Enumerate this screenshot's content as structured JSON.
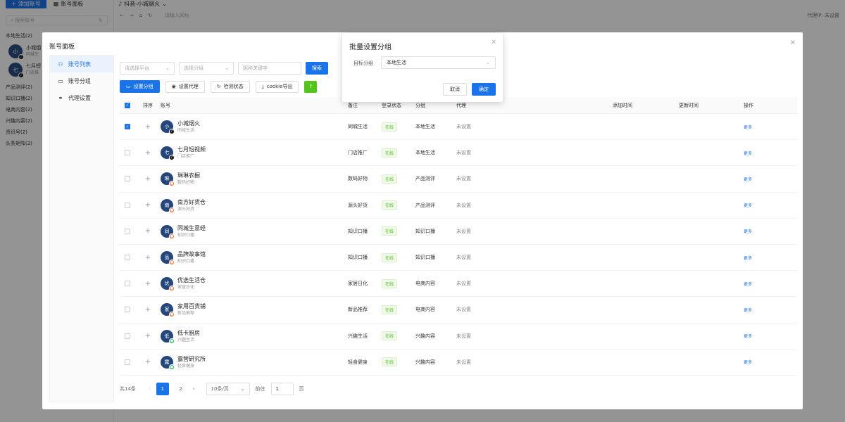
{
  "app": {
    "add_account_label": "添加账号",
    "account_panel_label": "账号面板",
    "search_placeholder": "搜索账号",
    "group_local_life": "本地生活(2)",
    "side_accounts": [
      {
        "avatar": "小",
        "name": "小城烟",
        "sub": "同城生"
      },
      {
        "avatar": "七",
        "name": "七月短",
        "sub": "门店推"
      }
    ],
    "categories": [
      "产品测评(2)",
      "知识口播(2)",
      "电商内容(2)",
      "兴趣内容(2)",
      "资讯号(2)",
      "头条矩阵(2)"
    ],
    "tab_title": "抖音-小城烟火",
    "address_placeholder": "请输入网址",
    "top_right": "代理IP: 未设置"
  },
  "panel": {
    "title": "账号面板",
    "nav": [
      {
        "label": "账号列表",
        "icon": "user-icon",
        "active": true
      },
      {
        "label": "账号分组",
        "icon": "folder-icon",
        "active": false
      },
      {
        "label": "代理设置",
        "icon": "link-icon",
        "active": false
      }
    ],
    "filters": {
      "platform_placeholder": "请选择平台",
      "group_placeholder": "选择分组",
      "keyword_placeholder": "昵称关键字",
      "search_label": "搜索"
    },
    "actions": {
      "set_group": "设置分组",
      "set_proxy": "设置代理",
      "check_status": "检测状态",
      "cookie_export": "cookie导出"
    },
    "table": {
      "headers": {
        "sort": "排序",
        "account": "账号",
        "note": "备注",
        "login_status": "登录状态",
        "group": "分组",
        "proxy": "代理",
        "added": "添加时间",
        "updated": "更新时间",
        "ops": "操作"
      },
      "rows": [
        {
          "avatar": "小",
          "platform": "dy",
          "name": "小城烟火",
          "sub": "同城生活",
          "note": "同城生活",
          "status": "在线",
          "group": "本地生活",
          "proxy": "未设置",
          "op": "更多",
          "checked": true
        },
        {
          "avatar": "七",
          "platform": "dy",
          "name": "七月短视频",
          "sub": "门店推广",
          "note": "门店推广",
          "status": "在线",
          "group": "本地生活",
          "proxy": "未设置",
          "op": "更多",
          "checked": false
        },
        {
          "avatar": "琳",
          "platform": "xhs",
          "name": "琳琳衣橱",
          "sub": "数码好物",
          "note": "数码好物",
          "status": "在线",
          "group": "产品测评",
          "proxy": "未设置",
          "op": "更多",
          "checked": false
        },
        {
          "avatar": "南",
          "platform": "xhs",
          "name": "南方好货仓",
          "sub": "源头好货",
          "note": "源头好货",
          "status": "在线",
          "group": "产品测评",
          "proxy": "未设置",
          "op": "更多",
          "checked": false
        },
        {
          "avatar": "同",
          "platform": "xhs",
          "name": "同城生意经",
          "sub": "知识口播",
          "note": "知识口播",
          "status": "在线",
          "group": "知识口播",
          "proxy": "未设置",
          "op": "更多",
          "checked": false
        },
        {
          "avatar": "品",
          "platform": "xhs",
          "name": "品牌故事馆",
          "sub": "知识口播",
          "note": "知识口播",
          "status": "在线",
          "group": "知识口播",
          "proxy": "未设置",
          "op": "更多",
          "checked": false
        },
        {
          "avatar": "优",
          "platform": "xhs",
          "name": "优选生活仓",
          "sub": "家居日化",
          "note": "家居日化",
          "status": "在线",
          "group": "电商内容",
          "proxy": "未设置",
          "op": "更多",
          "checked": false
        },
        {
          "avatar": "家",
          "platform": "xhs",
          "name": "家用百货铺",
          "sub": "新品推荐",
          "note": "新品推荐",
          "status": "在线",
          "group": "电商内容",
          "proxy": "未设置",
          "op": "更多",
          "checked": false
        },
        {
          "avatar": "低",
          "platform": "sph",
          "name": "低卡厨房",
          "sub": "兴趣生活",
          "note": "兴趣生活",
          "status": "在线",
          "group": "兴趣内容",
          "proxy": "未设置",
          "op": "更多",
          "checked": false
        },
        {
          "avatar": "露",
          "platform": "sph",
          "name": "露营研究所",
          "sub": "轻食健身",
          "note": "轻食健身",
          "status": "在线",
          "group": "兴趣内容",
          "proxy": "未设置",
          "op": "更多",
          "checked": false
        }
      ]
    },
    "pager": {
      "total": "共14条",
      "page1": "1",
      "page2": "2",
      "page_size": "10条/页",
      "goto_label": "前往",
      "goto_value": "1",
      "page_unit": "页"
    }
  },
  "dialog": {
    "title": "批量设置分组",
    "label": "目标分组",
    "selected": "本地生活",
    "cancel": "取消",
    "ok": "确定"
  },
  "colors": {
    "primary": "#1a73e8",
    "success": "#52c41a",
    "overlay": "rgba(0,0,0,0.42)"
  }
}
